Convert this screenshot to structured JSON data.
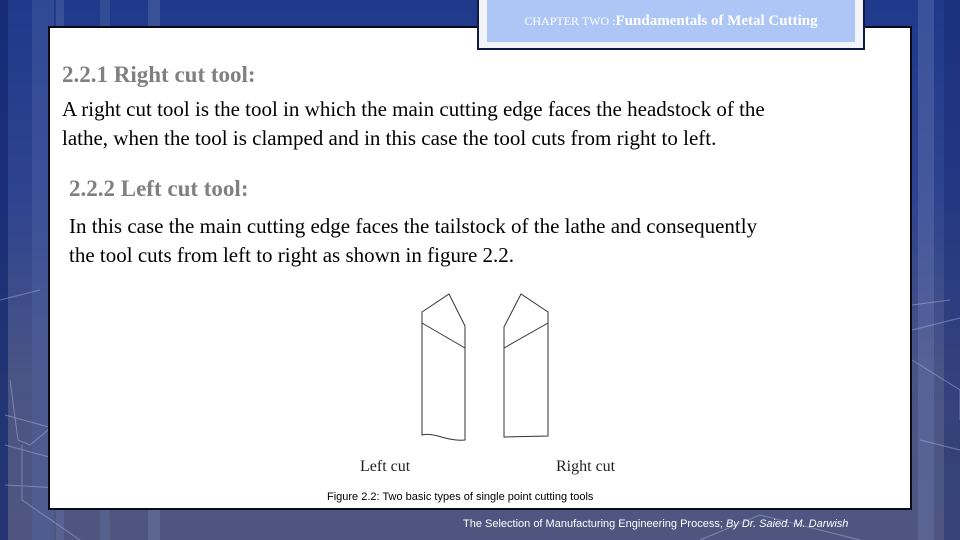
{
  "header": {
    "chapter_label": "CHAPTER TWO :",
    "chapter_title": "Fundamentals of Metal Cutting"
  },
  "sections": [
    {
      "heading": "2.2.1 Right cut tool:",
      "lines": [
        "A right cut tool is the tool in which the main cutting edge faces the headstock of the",
        "lathe, when the tool is clamped and in this case the tool cuts from right to left."
      ]
    },
    {
      "heading": "2.2.2 Left cut tool:",
      "lines": [
        "In this case the main cutting edge faces the tailstock of the lathe and consequently",
        "the tool cuts from left to right as shown in figure 2.2."
      ]
    }
  ],
  "figure": {
    "left_label": "Left cut",
    "right_label": "Right cut",
    "caption": "Figure 2.2: Two basic types of single point cutting tools"
  },
  "footer": {
    "title": "The Selection of Manufacturing Engineering Process;",
    "author": "By Dr. Saied. M. Darwish"
  }
}
